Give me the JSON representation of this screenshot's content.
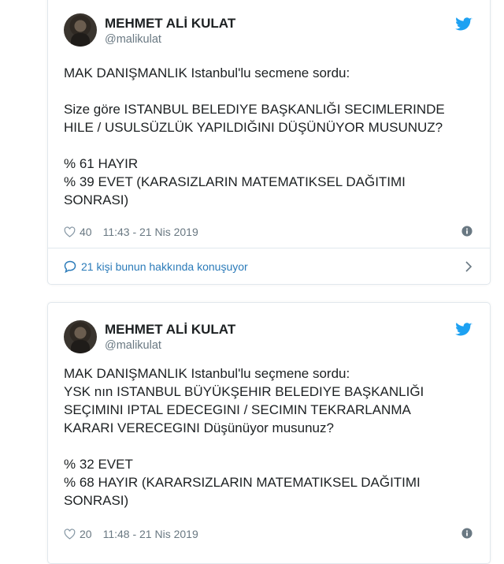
{
  "tweets": [
    {
      "author": {
        "name": "MEHMET ALİ KULAT",
        "handle": "@malikulat"
      },
      "lines": [
        "MAK DANIŞMANLIK Istanbul'lu secmene sordu:",
        "",
        "Size göre ISTANBUL BELEDIYE BAŞKANLIĞI SECIMLERINDE",
        "HILE / USULSÜZLÜK YAPILDIĞINI DÜŞÜNÜYOR MUSUNUZ?",
        "",
        "% 61 HAYIR",
        "% 39 EVET (KARASIZLARIN MATEMATIKSEL DAĞITIMI",
        "SONRASI)"
      ],
      "likes": "40",
      "timestamp": "11:43 - 21 Nis 2019",
      "conversation": "21 kişi bunun hakkında konuşuyor"
    },
    {
      "author": {
        "name": "MEHMET ALİ KULAT",
        "handle": "@malikulat"
      },
      "lines": [
        "MAK DANIŞMANLIK Istanbul'lu seçmene sordu:",
        "YSK nın ISTANBUL BÜYÜKŞEHIR BELEDIYE BAŞKANLIĞI",
        "SEÇIMINI IPTAL EDECEGINI / SECIMIN TEKRARLANMA",
        "KARARI VERECEGINI Düşünüyor musunuz?",
        "",
        "% 32 EVET",
        "% 68 HAYIR (KARARSIZLARIN MATEMATIKSEL DAĞITIMI",
        "SONRASI)"
      ],
      "likes": "20",
      "timestamp": "11:48 - 21 Nis 2019"
    }
  ],
  "icons": {
    "twitter": "twitter-bird-icon",
    "like": "heart-icon",
    "info": "info-icon",
    "conversation": "speech-bubble-icon",
    "chevron": "chevron-right-icon"
  },
  "colors": {
    "twitter_blue": "#1da1f2",
    "link_blue": "#2b7bb9",
    "meta_gray": "#697882",
    "border": "#e1e8ed"
  }
}
